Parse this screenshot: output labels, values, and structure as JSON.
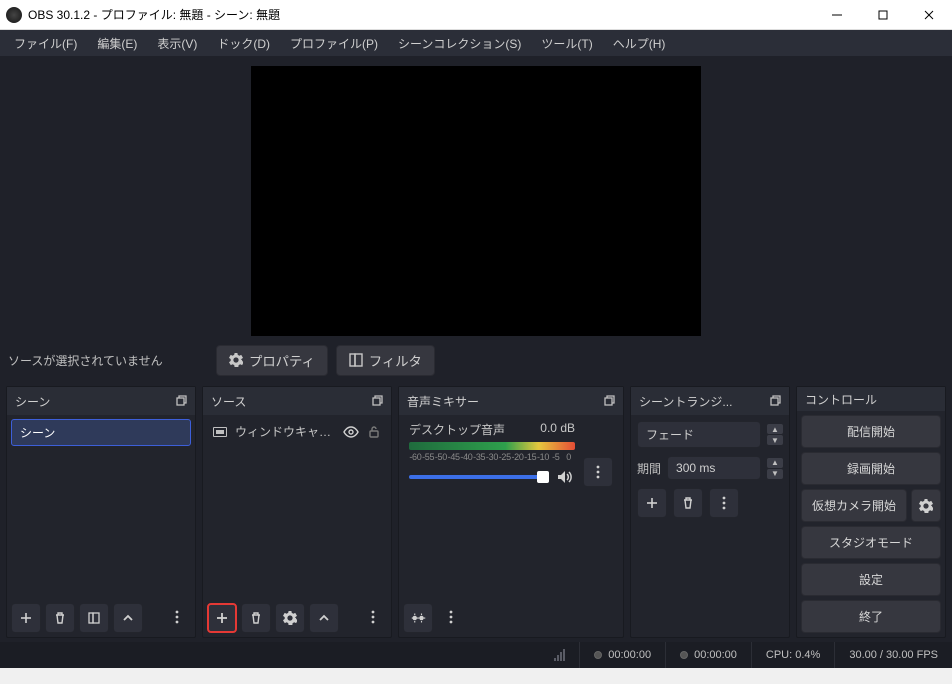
{
  "titlebar": {
    "title": "OBS 30.1.2 - プロファイル: 無題 - シーン: 無題"
  },
  "menu": {
    "file": "ファイル(F)",
    "edit": "編集(E)",
    "view": "表示(V)",
    "dock": "ドック(D)",
    "profile": "プロファイル(P)",
    "scenecol": "シーンコレクション(S)",
    "tools": "ツール(T)",
    "help": "ヘルプ(H)"
  },
  "sourcebar": {
    "noselection": "ソースが選択されていません",
    "properties": "プロパティ",
    "filters": "フィルタ"
  },
  "docks": {
    "scenes": {
      "title": "シーン",
      "items": [
        "シーン"
      ]
    },
    "sources": {
      "title": "ソース",
      "items": [
        {
          "name": "ウィンドウキャプチ",
          "visible": true,
          "locked": false
        }
      ]
    },
    "mixer": {
      "title": "音声ミキサー",
      "tracks": [
        {
          "name": "デスクトップ音声",
          "db": "0.0 dB"
        }
      ],
      "ticks": [
        "-60",
        "-55",
        "-50",
        "-45",
        "-40",
        "-35",
        "-30",
        "-25",
        "-20",
        "-15",
        "-10",
        "-5",
        "0"
      ]
    },
    "transitions": {
      "title": "シーントランジ...",
      "selected": "フェード",
      "duration_label": "期間",
      "duration_value": "300 ms"
    },
    "controls": {
      "title": "コントロール",
      "start_stream": "配信開始",
      "start_record": "録画開始",
      "virtual_cam": "仮想カメラ開始",
      "studio_mode": "スタジオモード",
      "settings": "設定",
      "exit": "終了"
    }
  },
  "status": {
    "stream_time": "00:00:00",
    "rec_time": "00:00:00",
    "cpu": "CPU: 0.4%",
    "fps": "30.00 / 30.00 FPS"
  }
}
